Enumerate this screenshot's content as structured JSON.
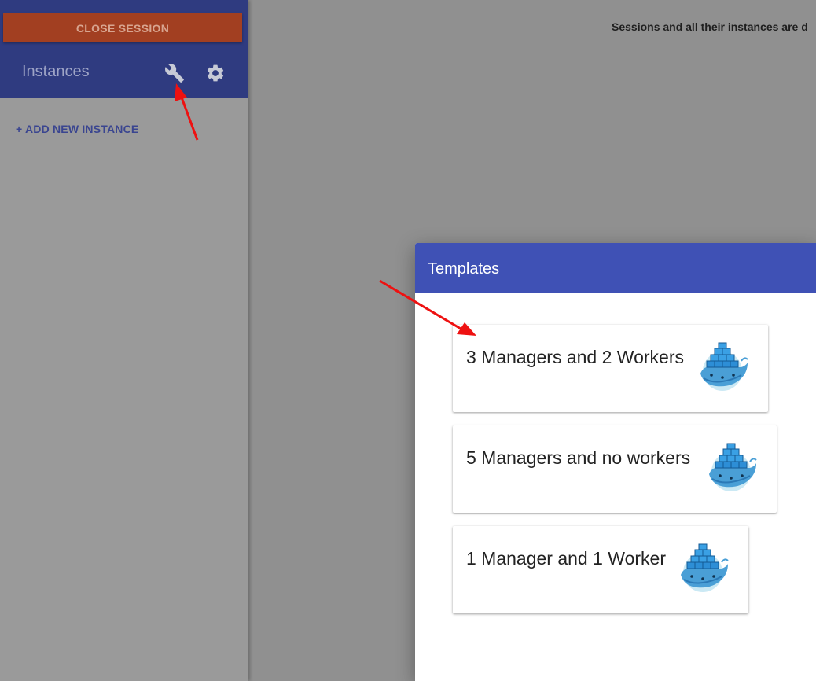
{
  "sidebar": {
    "close_session_label": "CLOSE SESSION",
    "title": "Instances",
    "wrench_icon": "wrench-icon",
    "settings_icon": "gear-icon",
    "add_instance_label": "+ ADD NEW INSTANCE"
  },
  "main": {
    "notice_text": "Sessions and all their instances are d"
  },
  "dialog": {
    "title": "Templates",
    "templates": [
      {
        "label": "3 Managers and 2 Workers",
        "icon": "docker-whale-icon"
      },
      {
        "label": "5 Managers and no workers",
        "icon": "docker-whale-icon"
      },
      {
        "label": "1 Manager and 1 Worker",
        "icon": "docker-whale-icon"
      }
    ]
  },
  "colors": {
    "sidebar_header": "#2f3b80",
    "close_button": "#a23f21",
    "dialog_header": "#3f51b5",
    "annotation_arrow": "#ee1111",
    "overlay_background": "#909090"
  }
}
